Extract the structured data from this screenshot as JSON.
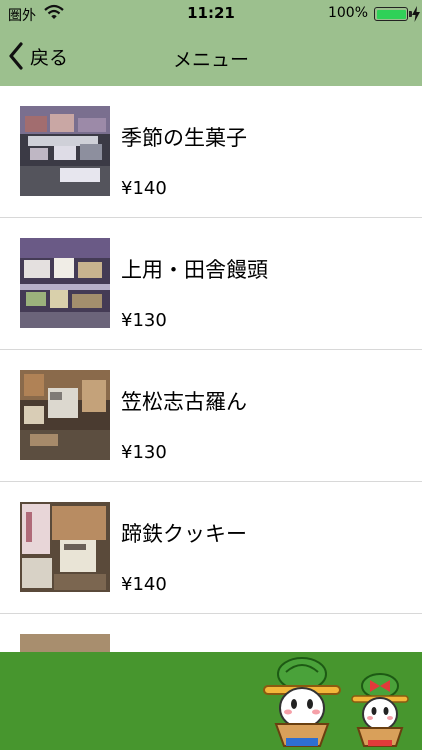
{
  "status_bar": {
    "carrier": "圏外",
    "time": "11:21",
    "battery": "100%"
  },
  "nav": {
    "back_label": "戻る",
    "title": "メニュー"
  },
  "menu_items": [
    {
      "name": "季節の生菓子",
      "price": "¥140"
    },
    {
      "name": "上用・田舎饅頭",
      "price": "¥130"
    },
    {
      "name": "笠松志古羅ん",
      "price": "¥130"
    },
    {
      "name": "蹄鉄クッキー",
      "price": "¥140"
    }
  ],
  "colors": {
    "header_bg": "#9cc08e",
    "footer_bg": "#47962e",
    "battery_fill": "#2fd158"
  },
  "icons": [
    "wifi-icon",
    "battery-icon",
    "charging-bolt-icon",
    "back-chevron-icon"
  ]
}
